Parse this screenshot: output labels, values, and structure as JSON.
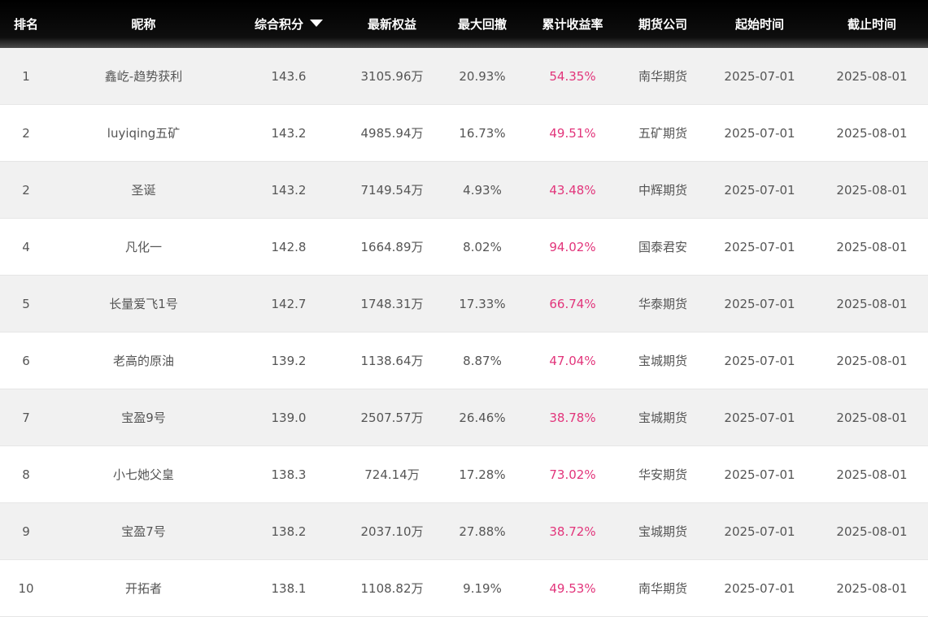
{
  "columns": [
    {
      "label": "排名"
    },
    {
      "label": "昵称"
    },
    {
      "label": "综合积分",
      "sort": "descending"
    },
    {
      "label": "最新权益"
    },
    {
      "label": "最大回撤"
    },
    {
      "label": "累计收益率"
    },
    {
      "label": "期货公司"
    },
    {
      "label": "起始时间"
    },
    {
      "label": "截止时间"
    }
  ],
  "colors": {
    "header_bg": "#000000",
    "row_alt_bg": "#f1f1f1",
    "text": "#555555",
    "return_rate": "#e2357b"
  },
  "rows": [
    [
      "1",
      "鑫屹-趋势获利",
      "143.6",
      "3105.96万",
      "20.93%",
      "54.35%",
      "南华期货",
      "2025-07-01",
      "2025-08-01"
    ],
    [
      "2",
      "luyiqing五矿",
      "143.2",
      "4985.94万",
      "16.73%",
      "49.51%",
      "五矿期货",
      "2025-07-01",
      "2025-08-01"
    ],
    [
      "2",
      "圣诞",
      "143.2",
      "7149.54万",
      "4.93%",
      "43.48%",
      "中辉期货",
      "2025-07-01",
      "2025-08-01"
    ],
    [
      "4",
      "凡化一",
      "142.8",
      "1664.89万",
      "8.02%",
      "94.02%",
      "国泰君安",
      "2025-07-01",
      "2025-08-01"
    ],
    [
      "5",
      "长量爱飞1号",
      "142.7",
      "1748.31万",
      "17.33%",
      "66.74%",
      "华泰期货",
      "2025-07-01",
      "2025-08-01"
    ],
    [
      "6",
      "老高的原油",
      "139.2",
      "1138.64万",
      "8.87%",
      "47.04%",
      "宝城期货",
      "2025-07-01",
      "2025-08-01"
    ],
    [
      "7",
      "宝盈9号",
      "139.0",
      "2507.57万",
      "26.46%",
      "38.78%",
      "宝城期货",
      "2025-07-01",
      "2025-08-01"
    ],
    [
      "8",
      "小七她父皇",
      "138.3",
      "724.14万",
      "17.28%",
      "73.02%",
      "华安期货",
      "2025-07-01",
      "2025-08-01"
    ],
    [
      "9",
      "宝盈7号",
      "138.2",
      "2037.10万",
      "27.88%",
      "38.72%",
      "宝城期货",
      "2025-07-01",
      "2025-08-01"
    ],
    [
      "10",
      "开拓者",
      "138.1",
      "1108.82万",
      "9.19%",
      "49.53%",
      "南华期货",
      "2025-07-01",
      "2025-08-01"
    ]
  ]
}
